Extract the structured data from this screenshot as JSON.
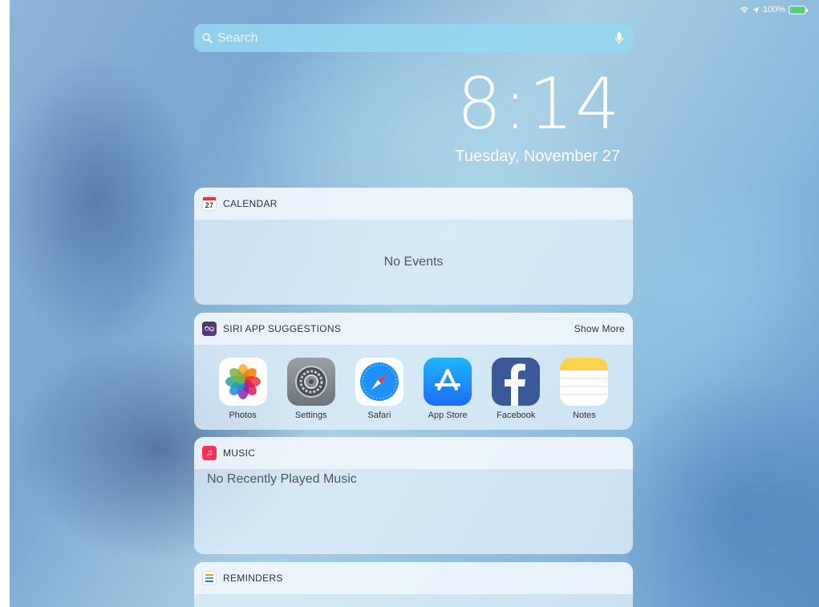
{
  "status_bar": {
    "battery_text": "100%",
    "battery_level": 1.0
  },
  "search": {
    "placeholder": "Search"
  },
  "clock": {
    "time": "8:14",
    "date": "Tuesday, November 27"
  },
  "widgets": {
    "calendar": {
      "title": "CALENDAR",
      "icon_number": "27",
      "empty_text": "No Events"
    },
    "siri": {
      "title": "SIRI APP SUGGESTIONS",
      "show_more": "Show More",
      "apps": [
        {
          "label": "Photos",
          "icon": "photos-icon"
        },
        {
          "label": "Settings",
          "icon": "settings-icon"
        },
        {
          "label": "Safari",
          "icon": "safari-icon"
        },
        {
          "label": "App Store",
          "icon": "app-store-icon"
        },
        {
          "label": "Facebook",
          "icon": "facebook-icon"
        },
        {
          "label": "Notes",
          "icon": "notes-icon"
        }
      ]
    },
    "music": {
      "title": "MUSIC",
      "empty_text": "No Recently Played Music"
    },
    "reminders": {
      "title": "REMINDERS"
    }
  },
  "colors": {
    "battery_green": "#4cd964",
    "music_red": "#fc3158",
    "facebook_blue": "#3b5998"
  }
}
